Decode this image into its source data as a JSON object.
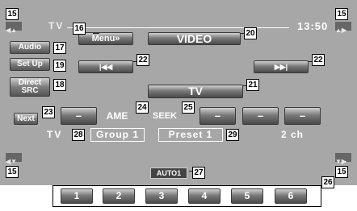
{
  "header": {
    "source_name": "TV",
    "clock": "13:50"
  },
  "buttons": {
    "menu": "Menu»",
    "video": "VIDEO",
    "audio": "Audio",
    "setup": "Set Up",
    "direct_src_line1": "Direct",
    "direct_src_line2": "SRC",
    "prev_glyph": "|◀◀",
    "next_glyph": "▶▶|",
    "tv": "TV",
    "next_tab": "Next",
    "ame": "AME",
    "seek": "SEEK",
    "dash": "–"
  },
  "status": {
    "band": "TV",
    "group": "Group 1",
    "preset": "Preset 1",
    "channel": "2 ch",
    "auto_mode": "AUTO1"
  },
  "preset_buttons": [
    "1",
    "2",
    "3",
    "4",
    "5",
    "6"
  ],
  "callouts": [
    "15",
    "16",
    "17",
    "18",
    "19",
    "20",
    "21",
    "22",
    "23",
    "24",
    "25",
    "26",
    "27",
    "28",
    "29"
  ]
}
